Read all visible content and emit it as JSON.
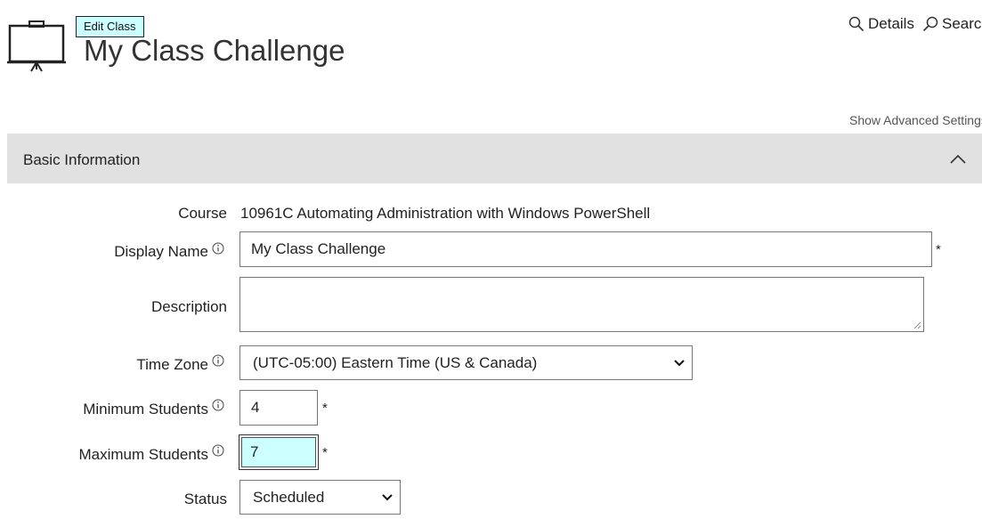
{
  "header": {
    "badge": "Edit Class",
    "title": "My Class Challenge",
    "details_label": "Details",
    "search_label": "Search",
    "advanced_settings": "Show Advanced Settings"
  },
  "section": {
    "title": "Basic Information"
  },
  "form": {
    "course": {
      "label": "Course",
      "value": "10961C Automating Administration with Windows PowerShell"
    },
    "display_name": {
      "label": "Display Name",
      "value": "My Class Challenge",
      "required": "*"
    },
    "description": {
      "label": "Description",
      "value": ""
    },
    "time_zone": {
      "label": "Time Zone",
      "value": "(UTC-05:00) Eastern Time (US & Canada)"
    },
    "min_students": {
      "label": "Minimum Students",
      "value": "4",
      "required": "*"
    },
    "max_students": {
      "label": "Maximum Students",
      "value": "7",
      "required": "*"
    },
    "status": {
      "label": "Status",
      "value": "Scheduled"
    }
  },
  "colors": {
    "badge_bg": "#ccffff",
    "section_bg": "#e1e1e1",
    "focus_bg": "#ccffff"
  },
  "icons": [
    "whiteboard-icon",
    "search-icon",
    "info-icon",
    "chevron-up-icon",
    "chevron-down-icon"
  ]
}
